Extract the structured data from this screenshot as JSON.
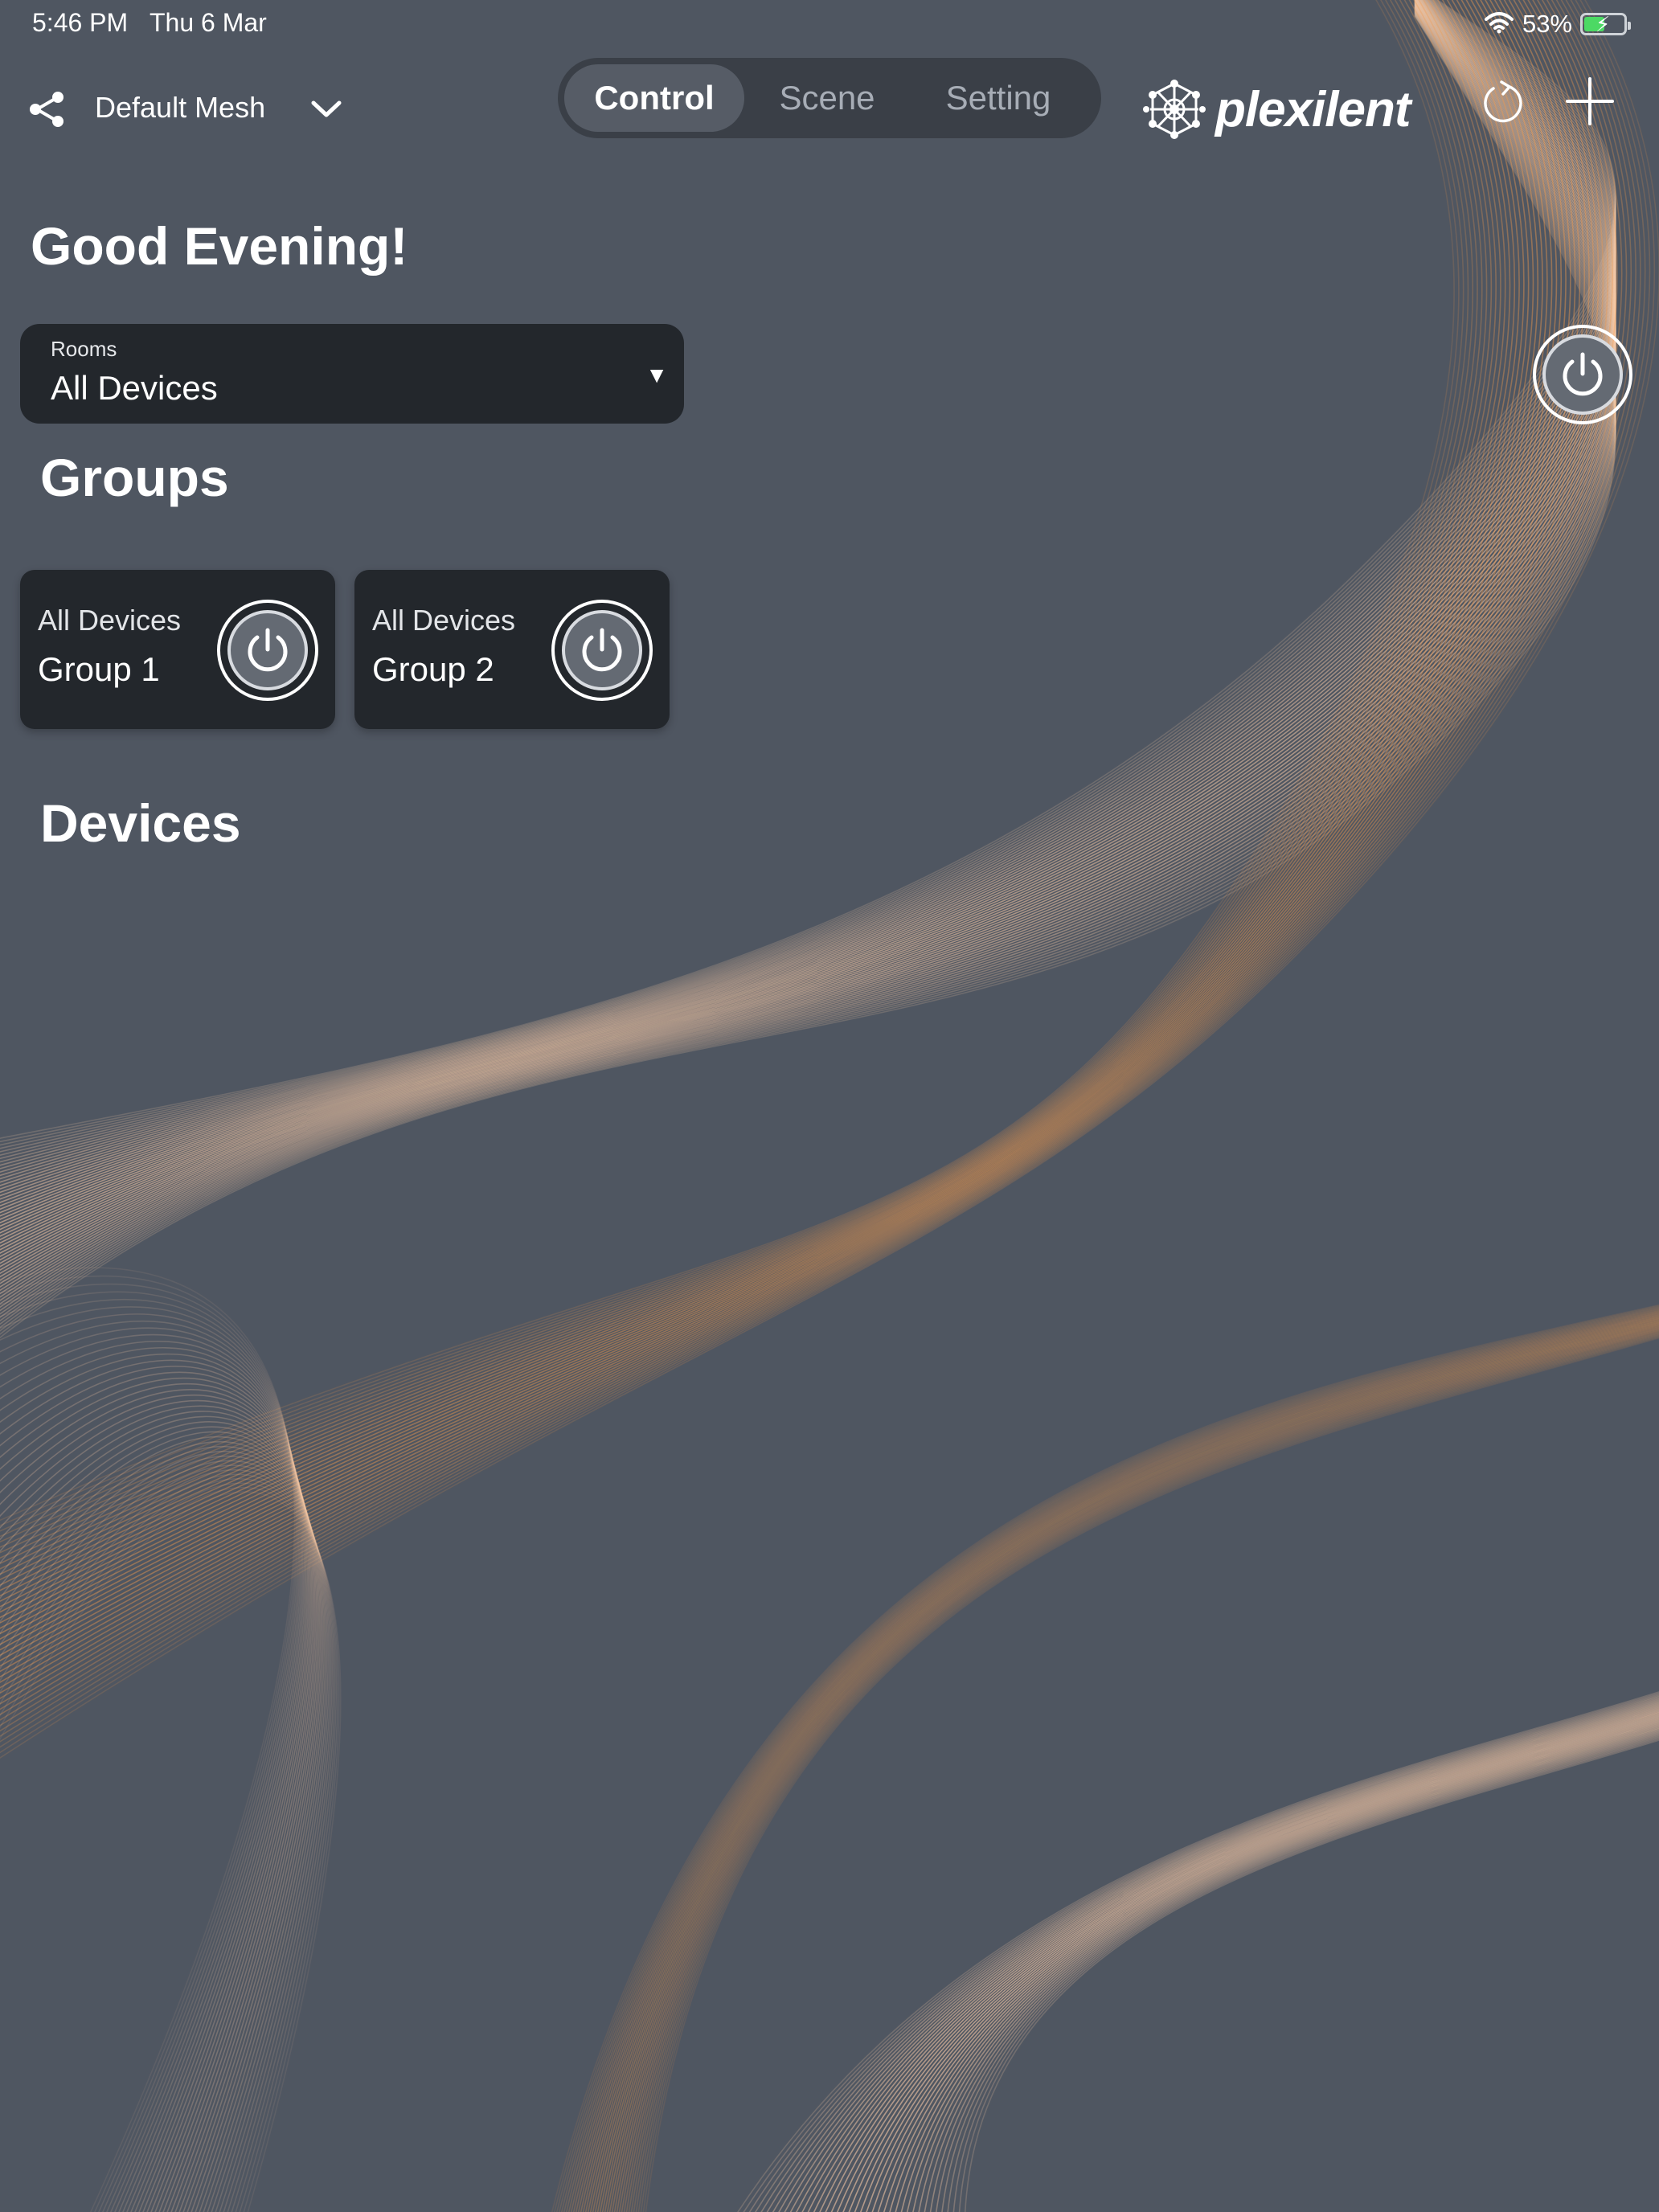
{
  "status_bar": {
    "time": "5:46 PM",
    "date": "Thu 6 Mar",
    "battery_percent": "53%",
    "battery_level": 0.53,
    "battery_charging": true,
    "wifi": true
  },
  "header": {
    "mesh_name": "Default Mesh",
    "tabs": [
      {
        "label": "Control",
        "active": true
      },
      {
        "label": "Scene",
        "active": false
      },
      {
        "label": "Setting",
        "active": false
      }
    ],
    "brand_name": "plexilent"
  },
  "greeting": "Good Evening!",
  "rooms": {
    "label": "Rooms",
    "selected": "All Devices"
  },
  "groups_section": {
    "title": "Groups",
    "items": [
      {
        "subtitle": "All Devices",
        "name": "Group 1"
      },
      {
        "subtitle": "All Devices",
        "name": "Group 2"
      }
    ]
  },
  "devices_section": {
    "title": "Devices"
  },
  "colors": {
    "background": "#4f5661",
    "card": "#23272c",
    "accent_orange": "#f29a4d",
    "accent_peach": "#f6c9a6",
    "battery_green": "#4cd964"
  },
  "icons": {
    "share": "share-icon",
    "chevron": "chevron-down-icon",
    "refresh": "refresh-icon",
    "add": "plus-icon",
    "power": "power-icon",
    "logo": "plexilent-logo-icon"
  }
}
